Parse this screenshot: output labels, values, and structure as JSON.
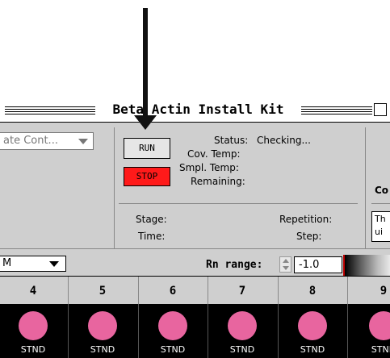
{
  "window": {
    "title": "Beta Actin Install Kit"
  },
  "controls": {
    "plate_popup": "ate Cont...",
    "run_label": "RUN",
    "stop_label": "STOP",
    "status_label": "Status:",
    "status_value": "Checking...",
    "cov_temp_label": "Cov. Temp:",
    "smpl_temp_label": "Smpl. Temp:",
    "remaining_label": "Remaining:",
    "stage_label": "Stage:",
    "repetition_label": "Repetition:",
    "time_label": "Time:",
    "step_label": "Step:",
    "right_col_heading": "Co",
    "right_col_text_1": "Th",
    "right_col_text_2": "ui"
  },
  "toolbar": {
    "units_popup": "M",
    "rn_range_label": "Rn range:",
    "rn_range_value": "-1.0"
  },
  "grid": {
    "columns": [
      "4",
      "5",
      "6",
      "7",
      "8",
      "9"
    ],
    "well_label": "STND",
    "well_color": "#e8659f"
  }
}
